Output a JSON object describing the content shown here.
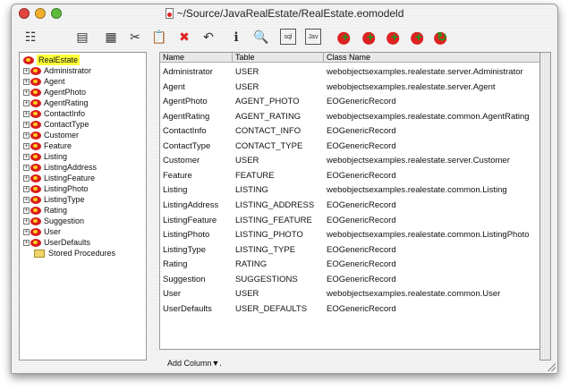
{
  "window": {
    "title": "~/Source/JavaRealEstate/RealEstate.eomodeld"
  },
  "toolbar": [
    {
      "name": "view-mode-icon",
      "glyph": "☷"
    },
    {
      "name": "copy-icon",
      "glyph": "▤"
    },
    {
      "name": "paste-icon",
      "glyph": "▦"
    },
    {
      "name": "cut-icon",
      "glyph": "✂"
    },
    {
      "name": "clipboard-icon",
      "glyph": "📋"
    },
    {
      "name": "delete-icon",
      "glyph": "✖"
    },
    {
      "name": "undo-icon",
      "glyph": "↶"
    },
    {
      "name": "info-icon",
      "glyph": "ℹ"
    },
    {
      "name": "browse-data-icon",
      "glyph": "🔍"
    },
    {
      "name": "sql-icon",
      "glyph": "sql"
    },
    {
      "name": "java-icon",
      "glyph": "Jav"
    },
    {
      "name": "add-entity-icon",
      "glyph": "+"
    },
    {
      "name": "add-attribute-icon",
      "glyph": "+"
    },
    {
      "name": "add-relationship-icon",
      "glyph": "+"
    },
    {
      "name": "add-fetch-spec-icon",
      "glyph": "+"
    },
    {
      "name": "add-stored-procedure-icon",
      "glyph": "↻"
    }
  ],
  "tree": {
    "root": "RealEstate",
    "items": [
      "Administrator",
      "Agent",
      "AgentPhoto",
      "AgentRating",
      "ContactInfo",
      "ContactType",
      "Customer",
      "Feature",
      "Listing",
      "ListingAddress",
      "ListingFeature",
      "ListingPhoto",
      "ListingType",
      "Rating",
      "Suggestion",
      "User",
      "UserDefaults"
    ],
    "stored_procedures": "Stored Procedures"
  },
  "table": {
    "columns": [
      "Name",
      "Table",
      "Class Name"
    ],
    "rows": [
      [
        "Administrator",
        "USER",
        "webobjectsexamples.realestate.server.Administrator"
      ],
      [
        "Agent",
        "USER",
        "webobjectsexamples.realestate.server.Agent"
      ],
      [
        "AgentPhoto",
        "AGENT_PHOTO",
        "EOGenericRecord"
      ],
      [
        "AgentRating",
        "AGENT_RATING",
        "webobjectsexamples.realestate.common.AgentRating"
      ],
      [
        "ContactInfo",
        "CONTACT_INFO",
        "EOGenericRecord"
      ],
      [
        "ContactType",
        "CONTACT_TYPE",
        "EOGenericRecord"
      ],
      [
        "Customer",
        "USER",
        "webobjectsexamples.realestate.server.Customer"
      ],
      [
        "Feature",
        "FEATURE",
        "EOGenericRecord"
      ],
      [
        "Listing",
        "LISTING",
        "webobjectsexamples.realestate.common.Listing"
      ],
      [
        "ListingAddress",
        "LISTING_ADDRESS",
        "EOGenericRecord"
      ],
      [
        "ListingFeature",
        "LISTING_FEATURE",
        "EOGenericRecord"
      ],
      [
        "ListingPhoto",
        "LISTING_PHOTO",
        "webobjectsexamples.realestate.common.ListingPhoto"
      ],
      [
        "ListingType",
        "LISTING_TYPE",
        "EOGenericRecord"
      ],
      [
        "Rating",
        "RATING",
        "EOGenericRecord"
      ],
      [
        "Suggestion",
        "SUGGESTIONS",
        "EOGenericRecord"
      ],
      [
        "User",
        "USER",
        "webobjectsexamples.realestate.common.User"
      ],
      [
        "UserDefaults",
        "USER_DEFAULTS",
        "EOGenericRecord"
      ]
    ]
  },
  "add_column": "Add Column▼."
}
